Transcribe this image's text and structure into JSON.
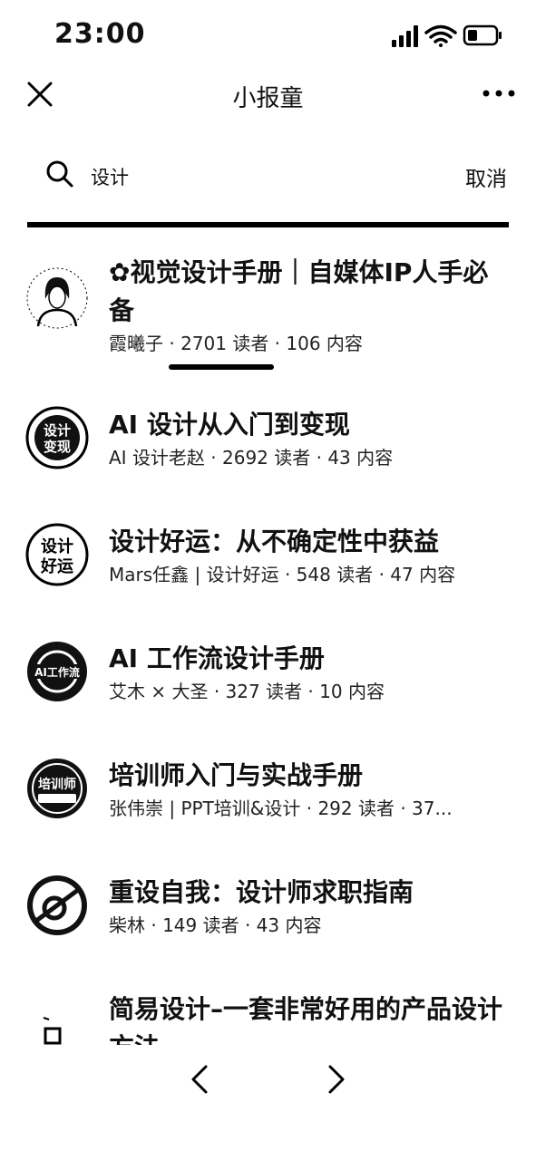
{
  "status_bar": {
    "time": "23:00",
    "icons": [
      "signal-icon",
      "wifi-icon",
      "battery-icon"
    ]
  },
  "nav": {
    "title": "小报童",
    "close_icon": "close-icon",
    "more_icon": "more-icon"
  },
  "search": {
    "query": "设计",
    "cancel_label": "取消",
    "icon": "search-icon"
  },
  "results": [
    {
      "title": "✿视觉设计手册｜自媒体IP人手必备",
      "meta": "霞曦子 · 2701 读者 · 106 内容"
    },
    {
      "title": "AI 设计从入门到变现",
      "meta": "AI 设计老赵 · 2692 读者 · 43 内容",
      "avatar_text": "设计变现"
    },
    {
      "title": "设计好运：从不确定性中获益",
      "meta": "Mars任鑫 | 设计好运 · 548 读者 · 47 内容",
      "avatar_text": "设计好运"
    },
    {
      "title": "AI 工作流设计手册",
      "meta": "艾木 × 大圣 · 327 读者 · 10 内容",
      "avatar_text": "AI工作流"
    },
    {
      "title": "培训师入门与实战手册",
      "meta": "张伟崇 | PPT培训&设计 · 292 读者 · 37...",
      "avatar_text": "培训师"
    },
    {
      "title": "重设自我：设计师求职指南",
      "meta": "柴林 · 149 读者 · 43 内容"
    },
    {
      "title": "简易设计–一套非常好用的产品设计方法",
      "meta": ""
    }
  ],
  "bottom_nav": {
    "back_icon": "chevron-left-icon",
    "forward_icon": "chevron-right-icon"
  }
}
